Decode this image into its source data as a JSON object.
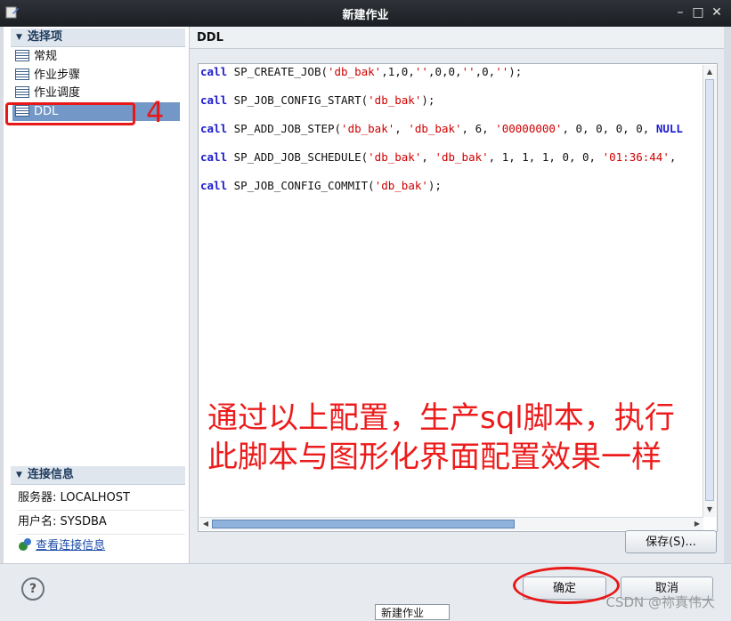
{
  "window": {
    "title": "新建作业"
  },
  "sidebar": {
    "section_title": "选择项",
    "items": [
      {
        "label": "常规"
      },
      {
        "label": "作业步骤"
      },
      {
        "label": "作业调度"
      },
      {
        "label": "DDL"
      }
    ]
  },
  "connection": {
    "section_title": "连接信息",
    "server_label": "服务器:",
    "server_value": "LOCALHOST",
    "user_label": "用户名:",
    "user_value": "SYSDBA",
    "view_link": "查看连接信息"
  },
  "panel": {
    "title": "DDL"
  },
  "ddl_lines": [
    [
      {
        "t": "call",
        "c": "kw"
      },
      {
        "t": " SP_CREATE_JOB(",
        "c": ""
      },
      {
        "t": "'db_bak'",
        "c": "str"
      },
      {
        "t": ",1,0,",
        "c": ""
      },
      {
        "t": "''",
        "c": "str"
      },
      {
        "t": ",0,0,",
        "c": ""
      },
      {
        "t": "''",
        "c": "str"
      },
      {
        "t": ",0,",
        "c": ""
      },
      {
        "t": "''",
        "c": "str"
      },
      {
        "t": ");",
        "c": ""
      }
    ],
    [
      {
        "t": "call",
        "c": "kw"
      },
      {
        "t": " SP_JOB_CONFIG_START(",
        "c": ""
      },
      {
        "t": "'db_bak'",
        "c": "str"
      },
      {
        "t": ");",
        "c": ""
      }
    ],
    [
      {
        "t": "call",
        "c": "kw"
      },
      {
        "t": " SP_ADD_JOB_STEP(",
        "c": ""
      },
      {
        "t": "'db_bak'",
        "c": "str"
      },
      {
        "t": ", ",
        "c": ""
      },
      {
        "t": "'db_bak'",
        "c": "str"
      },
      {
        "t": ", 6, ",
        "c": ""
      },
      {
        "t": "'00000000'",
        "c": "str"
      },
      {
        "t": ", 0, 0, 0, 0, ",
        "c": ""
      },
      {
        "t": "NULL",
        "c": "kw"
      }
    ],
    [
      {
        "t": "call",
        "c": "kw"
      },
      {
        "t": " SP_ADD_JOB_SCHEDULE(",
        "c": ""
      },
      {
        "t": "'db_bak'",
        "c": "str"
      },
      {
        "t": ", ",
        "c": ""
      },
      {
        "t": "'db_bak'",
        "c": "str"
      },
      {
        "t": ", 1, 1, 1, 0, 0, ",
        "c": ""
      },
      {
        "t": "'01:36:44'",
        "c": "str"
      },
      {
        "t": ",",
        "c": ""
      }
    ],
    [
      {
        "t": "call",
        "c": "kw"
      },
      {
        "t": " SP_JOB_CONFIG_COMMIT(",
        "c": ""
      },
      {
        "t": "'db_bak'",
        "c": "str"
      },
      {
        "t": ");",
        "c": ""
      }
    ]
  ],
  "annotation": {
    "line1": "通过以上配置，生产sql脚本，执行",
    "line2": "此脚本与图形化界面配置效果一样",
    "step_number": "4"
  },
  "buttons": {
    "save": "保存(S)...",
    "ok": "确定",
    "cancel": "取消"
  },
  "help_symbol": "?",
  "tooltip": "新建作业",
  "watermark": "CSDN @祢真伟大",
  "colors": {
    "highlight_red": "#e81818",
    "selection_blue": "#7397c6",
    "keyword_blue": "#1b1bd0",
    "string_red": "#d00000"
  }
}
